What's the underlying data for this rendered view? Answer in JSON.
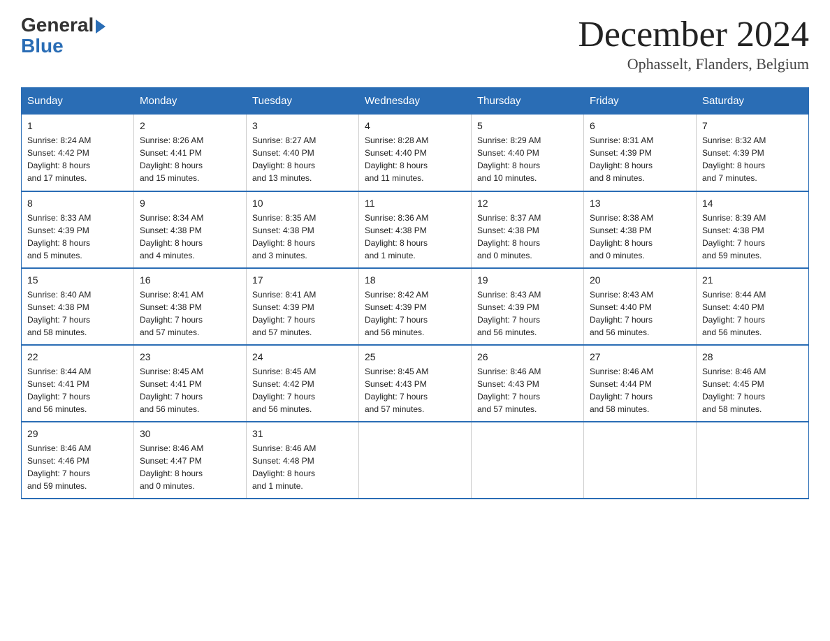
{
  "header": {
    "logo_general": "General",
    "logo_blue": "Blue",
    "month_title": "December 2024",
    "location": "Ophasselt, Flanders, Belgium"
  },
  "days_of_week": [
    "Sunday",
    "Monday",
    "Tuesday",
    "Wednesday",
    "Thursday",
    "Friday",
    "Saturday"
  ],
  "weeks": [
    [
      {
        "day": "1",
        "info": "Sunrise: 8:24 AM\nSunset: 4:42 PM\nDaylight: 8 hours\nand 17 minutes."
      },
      {
        "day": "2",
        "info": "Sunrise: 8:26 AM\nSunset: 4:41 PM\nDaylight: 8 hours\nand 15 minutes."
      },
      {
        "day": "3",
        "info": "Sunrise: 8:27 AM\nSunset: 4:40 PM\nDaylight: 8 hours\nand 13 minutes."
      },
      {
        "day": "4",
        "info": "Sunrise: 8:28 AM\nSunset: 4:40 PM\nDaylight: 8 hours\nand 11 minutes."
      },
      {
        "day": "5",
        "info": "Sunrise: 8:29 AM\nSunset: 4:40 PM\nDaylight: 8 hours\nand 10 minutes."
      },
      {
        "day": "6",
        "info": "Sunrise: 8:31 AM\nSunset: 4:39 PM\nDaylight: 8 hours\nand 8 minutes."
      },
      {
        "day": "7",
        "info": "Sunrise: 8:32 AM\nSunset: 4:39 PM\nDaylight: 8 hours\nand 7 minutes."
      }
    ],
    [
      {
        "day": "8",
        "info": "Sunrise: 8:33 AM\nSunset: 4:39 PM\nDaylight: 8 hours\nand 5 minutes."
      },
      {
        "day": "9",
        "info": "Sunrise: 8:34 AM\nSunset: 4:38 PM\nDaylight: 8 hours\nand 4 minutes."
      },
      {
        "day": "10",
        "info": "Sunrise: 8:35 AM\nSunset: 4:38 PM\nDaylight: 8 hours\nand 3 minutes."
      },
      {
        "day": "11",
        "info": "Sunrise: 8:36 AM\nSunset: 4:38 PM\nDaylight: 8 hours\nand 1 minute."
      },
      {
        "day": "12",
        "info": "Sunrise: 8:37 AM\nSunset: 4:38 PM\nDaylight: 8 hours\nand 0 minutes."
      },
      {
        "day": "13",
        "info": "Sunrise: 8:38 AM\nSunset: 4:38 PM\nDaylight: 8 hours\nand 0 minutes."
      },
      {
        "day": "14",
        "info": "Sunrise: 8:39 AM\nSunset: 4:38 PM\nDaylight: 7 hours\nand 59 minutes."
      }
    ],
    [
      {
        "day": "15",
        "info": "Sunrise: 8:40 AM\nSunset: 4:38 PM\nDaylight: 7 hours\nand 58 minutes."
      },
      {
        "day": "16",
        "info": "Sunrise: 8:41 AM\nSunset: 4:38 PM\nDaylight: 7 hours\nand 57 minutes."
      },
      {
        "day": "17",
        "info": "Sunrise: 8:41 AM\nSunset: 4:39 PM\nDaylight: 7 hours\nand 57 minutes."
      },
      {
        "day": "18",
        "info": "Sunrise: 8:42 AM\nSunset: 4:39 PM\nDaylight: 7 hours\nand 56 minutes."
      },
      {
        "day": "19",
        "info": "Sunrise: 8:43 AM\nSunset: 4:39 PM\nDaylight: 7 hours\nand 56 minutes."
      },
      {
        "day": "20",
        "info": "Sunrise: 8:43 AM\nSunset: 4:40 PM\nDaylight: 7 hours\nand 56 minutes."
      },
      {
        "day": "21",
        "info": "Sunrise: 8:44 AM\nSunset: 4:40 PM\nDaylight: 7 hours\nand 56 minutes."
      }
    ],
    [
      {
        "day": "22",
        "info": "Sunrise: 8:44 AM\nSunset: 4:41 PM\nDaylight: 7 hours\nand 56 minutes."
      },
      {
        "day": "23",
        "info": "Sunrise: 8:45 AM\nSunset: 4:41 PM\nDaylight: 7 hours\nand 56 minutes."
      },
      {
        "day": "24",
        "info": "Sunrise: 8:45 AM\nSunset: 4:42 PM\nDaylight: 7 hours\nand 56 minutes."
      },
      {
        "day": "25",
        "info": "Sunrise: 8:45 AM\nSunset: 4:43 PM\nDaylight: 7 hours\nand 57 minutes."
      },
      {
        "day": "26",
        "info": "Sunrise: 8:46 AM\nSunset: 4:43 PM\nDaylight: 7 hours\nand 57 minutes."
      },
      {
        "day": "27",
        "info": "Sunrise: 8:46 AM\nSunset: 4:44 PM\nDaylight: 7 hours\nand 58 minutes."
      },
      {
        "day": "28",
        "info": "Sunrise: 8:46 AM\nSunset: 4:45 PM\nDaylight: 7 hours\nand 58 minutes."
      }
    ],
    [
      {
        "day": "29",
        "info": "Sunrise: 8:46 AM\nSunset: 4:46 PM\nDaylight: 7 hours\nand 59 minutes."
      },
      {
        "day": "30",
        "info": "Sunrise: 8:46 AM\nSunset: 4:47 PM\nDaylight: 8 hours\nand 0 minutes."
      },
      {
        "day": "31",
        "info": "Sunrise: 8:46 AM\nSunset: 4:48 PM\nDaylight: 8 hours\nand 1 minute."
      },
      {
        "day": "",
        "info": ""
      },
      {
        "day": "",
        "info": ""
      },
      {
        "day": "",
        "info": ""
      },
      {
        "day": "",
        "info": ""
      }
    ]
  ]
}
